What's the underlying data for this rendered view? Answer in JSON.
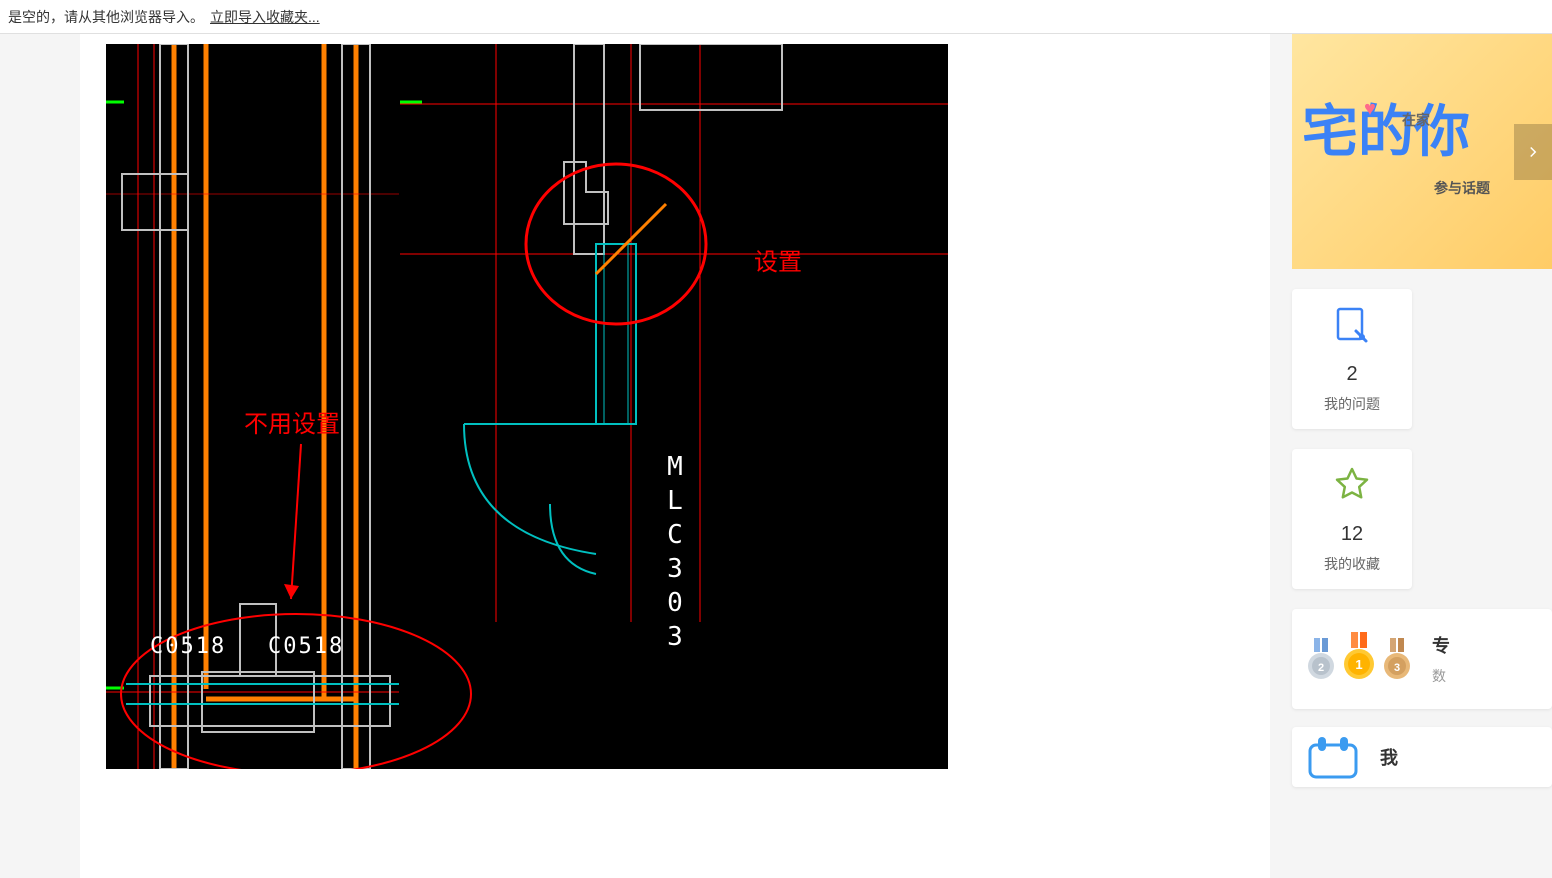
{
  "top_bar": {
    "empty_text": "是空的，请从其他浏览器导入。",
    "import_link": "立即导入收藏夹..."
  },
  "cad": {
    "annotation_set": "设置",
    "annotation_noset": "不用设置",
    "label_c0518_1": "C0518",
    "label_c0518_2": "C0518",
    "label_mlc": "MLC303"
  },
  "promo": {
    "brand_big": "宅的你",
    "brand_small": "在家",
    "cta": "参与话题"
  },
  "stats": {
    "questions": {
      "count": "2",
      "label": "我的问题"
    },
    "favorites": {
      "count": "12",
      "label": "我的收藏"
    }
  },
  "badges": {
    "title": "专",
    "subtitle": "数"
  },
  "calendar": {
    "title": "我"
  }
}
